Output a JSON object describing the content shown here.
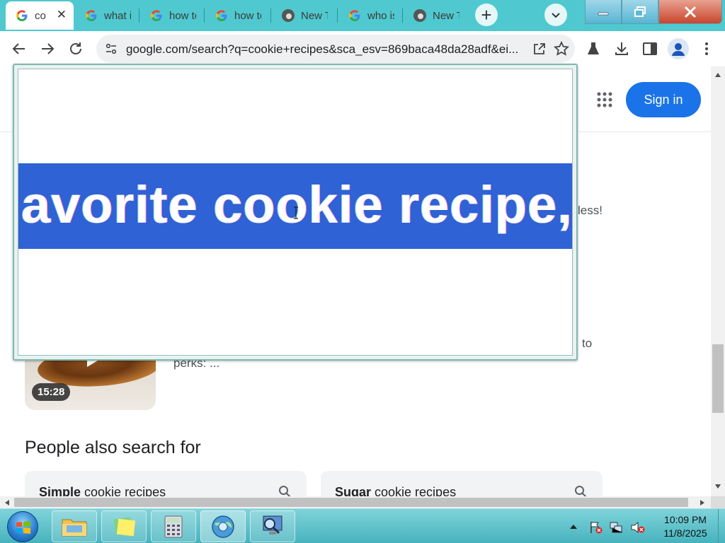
{
  "browser": {
    "tabs": [
      {
        "title": "co",
        "icon": "google-g-icon",
        "active": true
      },
      {
        "title": "what i",
        "icon": "google-g-icon"
      },
      {
        "title": "how to",
        "icon": "google-g-icon"
      },
      {
        "title": "how to",
        "icon": "google-g-icon"
      },
      {
        "title": "New T",
        "icon": "chrome-icon"
      },
      {
        "title": "who is",
        "icon": "google-g-icon"
      },
      {
        "title": "New T",
        "icon": "chrome-icon"
      }
    ],
    "url": "google.com/search?q=cookie+recipes&sca_esv=869baca48da28adf&ei..."
  },
  "page": {
    "sign_in": "Sign in",
    "snippet_end_1": "less!",
    "snippet_end_2": "to",
    "snippet_perks": "perks: ...",
    "video_duration": "15:28",
    "people_also_search_heading": "People also search for",
    "suggestions": [
      {
        "bold": "Simple",
        "rest": " cookie recipes"
      },
      {
        "bold": "Sugar",
        "rest": " cookie recipes"
      }
    ]
  },
  "magnifier": {
    "text": "avorite cookie recipe, a"
  },
  "taskbar": {
    "time": "10:09 PM",
    "date": "11/8/2025"
  },
  "colors": {
    "titlebar": "#4fc9cf",
    "signin": "#1a73e8",
    "selection": "#2f62d4",
    "taskbar": "#47b3bd"
  }
}
